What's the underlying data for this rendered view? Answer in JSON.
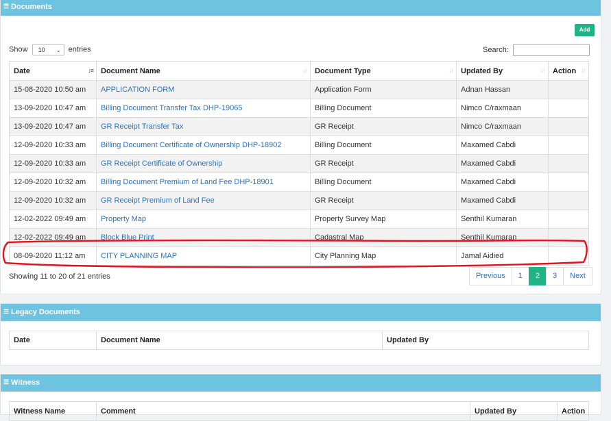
{
  "documents": {
    "title": "Documents",
    "add_label": "Add",
    "show_label": "Show",
    "entries_label": "entries",
    "page_size": "10",
    "search_label": "Search:",
    "search_value": "",
    "columns": [
      "Date",
      "Document Name",
      "Document Type",
      "Updated By",
      "Action"
    ],
    "rows": [
      {
        "date": "15-08-2020 10:50 am",
        "name": "APPLICATION FORM",
        "type": "Application Form",
        "by": "Adnan Hassan",
        "action": ""
      },
      {
        "date": "13-09-2020 10:47 am",
        "name": "Billing Document Transfer Tax DHP-19065",
        "type": "Billing Document",
        "by": "Nimco C/raxmaan",
        "action": ""
      },
      {
        "date": "13-09-2020 10:47 am",
        "name": "GR Receipt Transfer Tax",
        "type": "GR Receipt",
        "by": "Nimco C/raxmaan",
        "action": ""
      },
      {
        "date": "12-09-2020 10:33 am",
        "name": "Billing Document Certificate of Ownership DHP-18902",
        "type": "Billing Document",
        "by": "Maxamed Cabdi",
        "action": ""
      },
      {
        "date": "12-09-2020 10:33 am",
        "name": "GR Receipt Certificate of Ownership",
        "type": "GR Receipt",
        "by": "Maxamed Cabdi",
        "action": ""
      },
      {
        "date": "12-09-2020 10:32 am",
        "name": "Billing Document Premium of Land Fee DHP-18901",
        "type": "Billing Document",
        "by": "Maxamed Cabdi",
        "action": ""
      },
      {
        "date": "12-09-2020 10:32 am",
        "name": "GR Receipt Premium of Land Fee",
        "type": "GR Receipt",
        "by": "Maxamed Cabdi",
        "action": ""
      },
      {
        "date": "12-02-2022 09:49 am",
        "name": "Property Map",
        "type": "Property Survey Map",
        "by": "Senthil Kumaran",
        "action": ""
      },
      {
        "date": "12-02-2022 09:49 am",
        "name": "Block Blue Print",
        "type": "Cadastral Map",
        "by": "Senthil Kumaran",
        "action": ""
      },
      {
        "date": "08-09-2020 11:12 am",
        "name": "CITY PLANNING MAP",
        "type": "City Planning Map",
        "by": "Jamal Aidied",
        "action": ""
      }
    ],
    "info": "Showing 11 to 20 of 21 entries",
    "pagination": {
      "previous": "Previous",
      "pages": [
        "1",
        "2",
        "3"
      ],
      "active_page": "2",
      "next": "Next"
    }
  },
  "legacy": {
    "title": "Legacy Documents",
    "columns": [
      "Date",
      "Document Name",
      "Updated By"
    ]
  },
  "witness": {
    "title": "Witness",
    "columns": [
      "Witness Name",
      "Comment",
      "Updated By",
      "Action"
    ]
  },
  "colors": {
    "header": "#6ec3e0",
    "accent": "#1fb386",
    "link": "#2f72b8",
    "annotation": "#e0141e"
  }
}
